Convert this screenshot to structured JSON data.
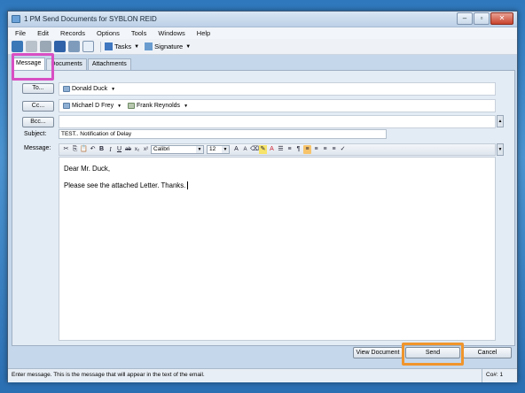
{
  "window": {
    "title": "1 PM Send Documents for SYBLON REID",
    "minimize_label": "–",
    "maximize_label": "▫",
    "close_label": "✕"
  },
  "menu": [
    "File",
    "Edit",
    "Records",
    "Options",
    "Tools",
    "Windows",
    "Help"
  ],
  "toolbar": {
    "tasks_label": "Tasks",
    "signature_label": "Signature"
  },
  "tabs": [
    "Message",
    "Documents",
    "Attachments"
  ],
  "fields": {
    "to_button": "To...",
    "cc_button": "Cc...",
    "bcc_button": "Bcc...",
    "subject_label": "Subject:",
    "message_label": "Message:",
    "to_recipients": [
      "Donald  Duck"
    ],
    "cc_recipients": [
      "Michael D Frey",
      "Frank  Reynolds"
    ],
    "subject_value": "TEST.. Notification of Delay"
  },
  "format": {
    "font": "Calibri",
    "size": "12"
  },
  "message_body": {
    "greeting": "Dear Mr. Duck,",
    "line1": "Please see the attached Letter.  Thanks."
  },
  "buttons": {
    "view_document": "View Document",
    "send": "Send",
    "cancel": "Cancel"
  },
  "status": {
    "text": "Enter message. This is the message that will appear in the text of the email.",
    "position": "Co#: 1"
  },
  "colors": {
    "highlight_message_tab": "#d84fc3",
    "highlight_send": "#f0952c"
  }
}
